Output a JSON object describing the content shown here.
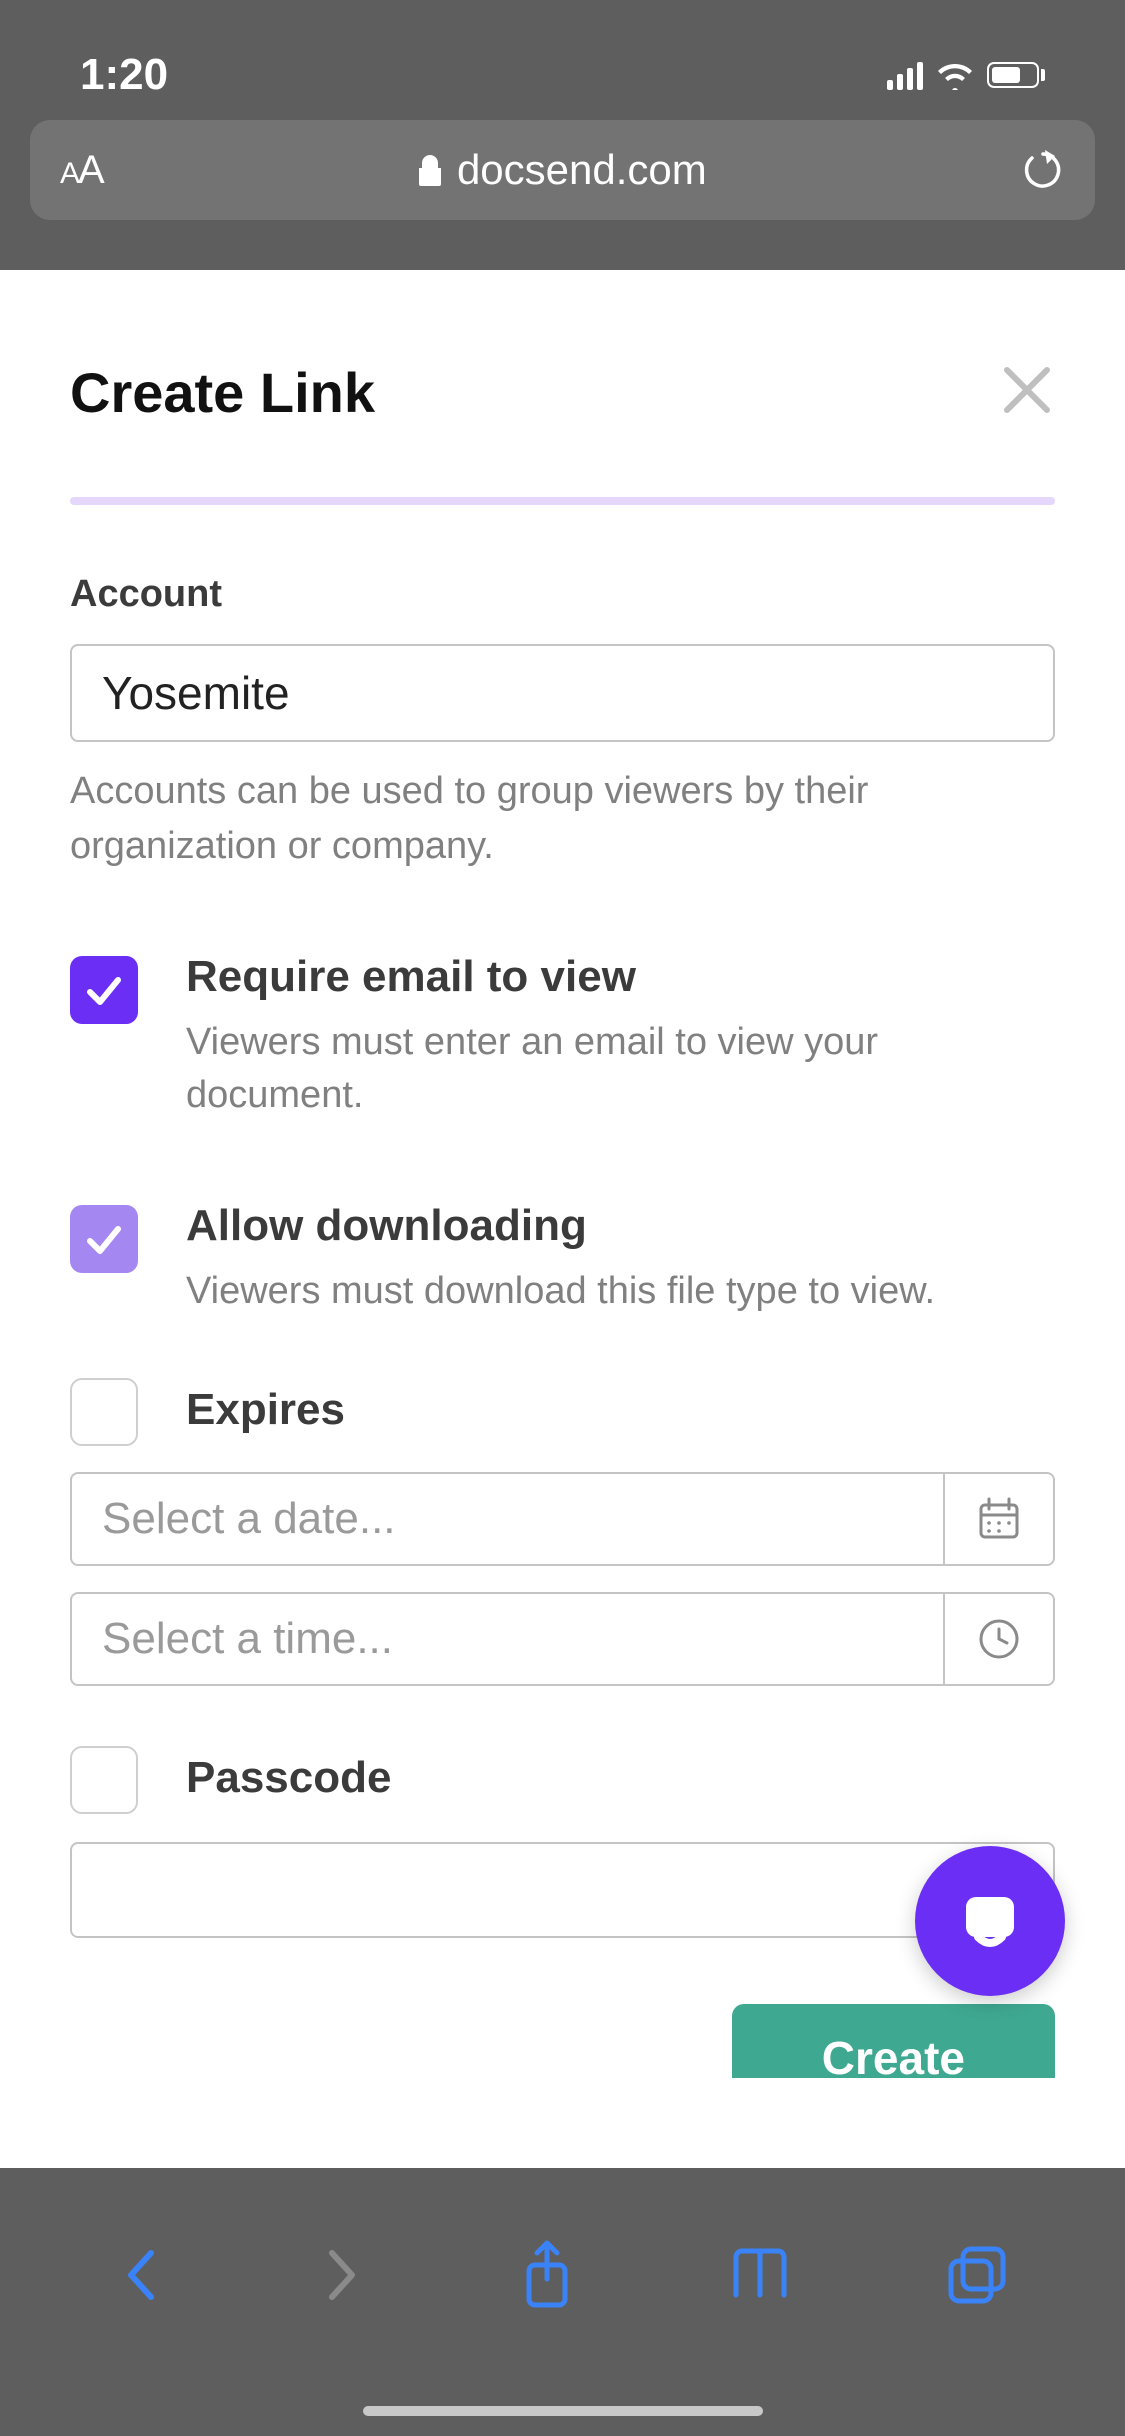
{
  "status": {
    "time": "1:20"
  },
  "browser": {
    "domain": "docsend.com"
  },
  "page": {
    "title": "Create Link",
    "account": {
      "label": "Account",
      "value": "Yosemite",
      "helper": "Accounts can be used to group viewers by their organization or company."
    },
    "require_email": {
      "title": "Require email to view",
      "desc": "Viewers must enter an email to view your document."
    },
    "allow_download": {
      "title": "Allow downloading",
      "desc": "Viewers must download this file type to view."
    },
    "expires": {
      "title": "Expires",
      "date_placeholder": "Select a date...",
      "time_placeholder": "Select a time..."
    },
    "passcode": {
      "title": "Passcode"
    },
    "create_button": "Create"
  }
}
